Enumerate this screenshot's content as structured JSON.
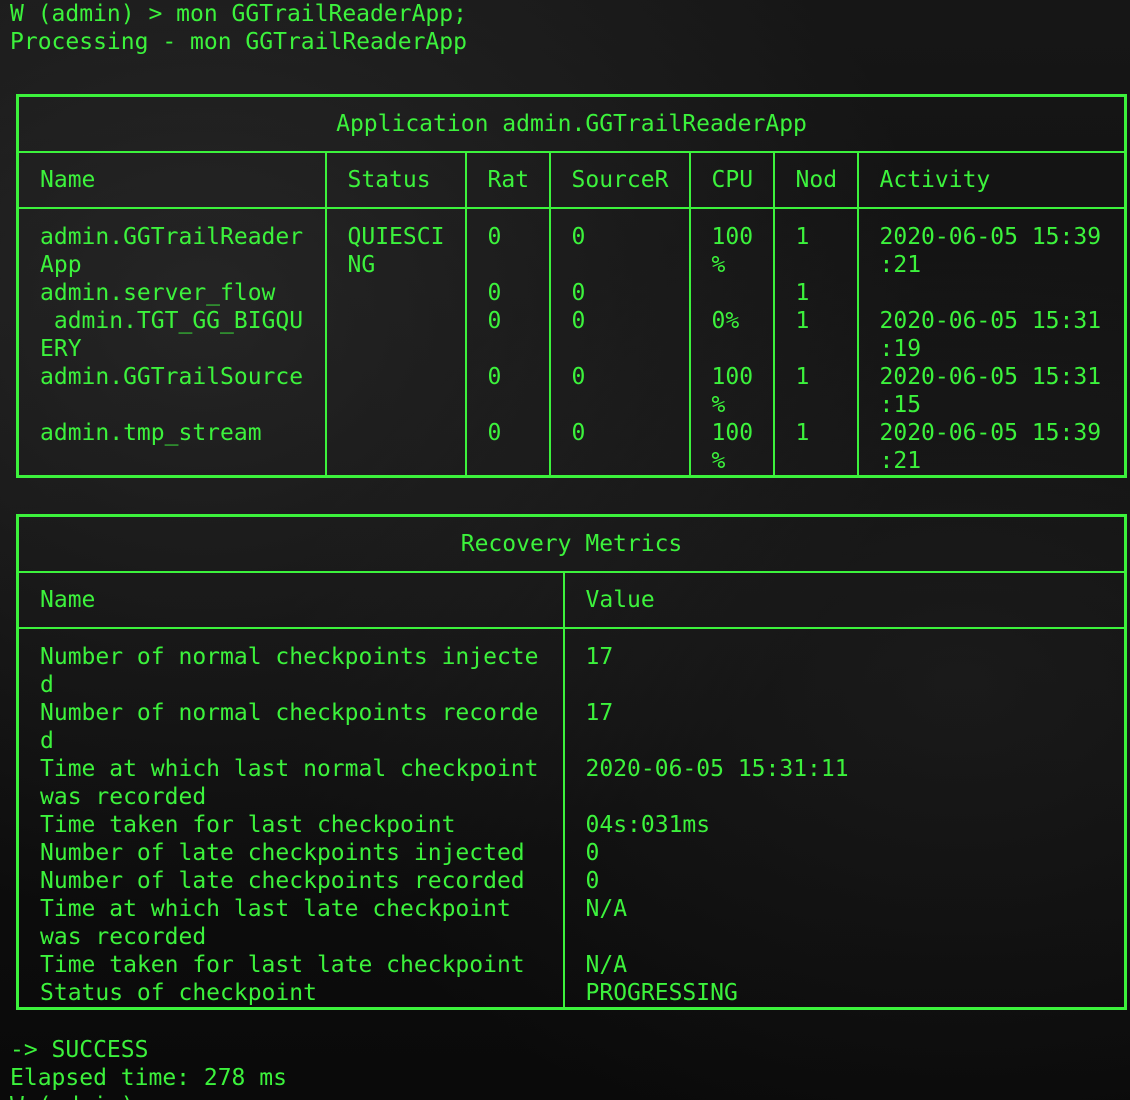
{
  "terminal": {
    "command_line": "W (admin) > mon GGTrailReaderApp;",
    "processing_line": "Processing - mon GGTrailReaderApp",
    "result_line": "-> SUCCESS",
    "elapsed_line": "Elapsed time: 278 ms",
    "next_prompt": "W (admin) >"
  },
  "app_table": {
    "title": "Application admin.GGTrailReaderApp",
    "headers": [
      "Name",
      "Status",
      "Rat",
      "SourceR",
      "CPU",
      "Nod",
      "Activity"
    ],
    "rows": [
      [
        "admin.GGTrailReader\nApp",
        "QUIESCI\nNG",
        "0",
        "0",
        "100\n%",
        "1",
        "2020-06-05 15:39\n:21"
      ],
      [
        "admin.server_flow",
        "",
        "0",
        "0",
        "",
        "1",
        ""
      ],
      [
        " admin.TGT_GG_BIGQU\nERY",
        "",
        "0",
        "0",
        "0%",
        "1",
        "2020-06-05 15:31\n:19"
      ],
      [
        "admin.GGTrailSource",
        "",
        "0",
        "0",
        "100\n%",
        "1",
        "2020-06-05 15:31\n:15"
      ],
      [
        "admin.tmp_stream",
        "",
        "0",
        "0",
        "100\n%",
        "1",
        "2020-06-05 15:39\n:21"
      ]
    ]
  },
  "recovery_table": {
    "title": "Recovery Metrics",
    "headers": [
      "Name",
      "Value"
    ],
    "rows": [
      [
        "Number of normal checkpoints injecte\nd",
        "17"
      ],
      [
        "Number of normal checkpoints recorde\nd",
        "17"
      ],
      [
        "Time at which last normal checkpoint\nwas recorded",
        "2020-06-05 15:31:11"
      ],
      [
        "Time taken for last checkpoint",
        "04s:031ms"
      ],
      [
        "Number of late checkpoints injected",
        "0"
      ],
      [
        "Number of late checkpoints recorded",
        "0"
      ],
      [
        "Time at which last late checkpoint\nwas recorded",
        "N/A"
      ],
      [
        "Time taken for last late checkpoint",
        "N/A"
      ],
      [
        "Status of checkpoint",
        "PROGRESSING"
      ]
    ]
  },
  "colors": {
    "text": "#3cf23c",
    "background": "#0c0c0c"
  }
}
